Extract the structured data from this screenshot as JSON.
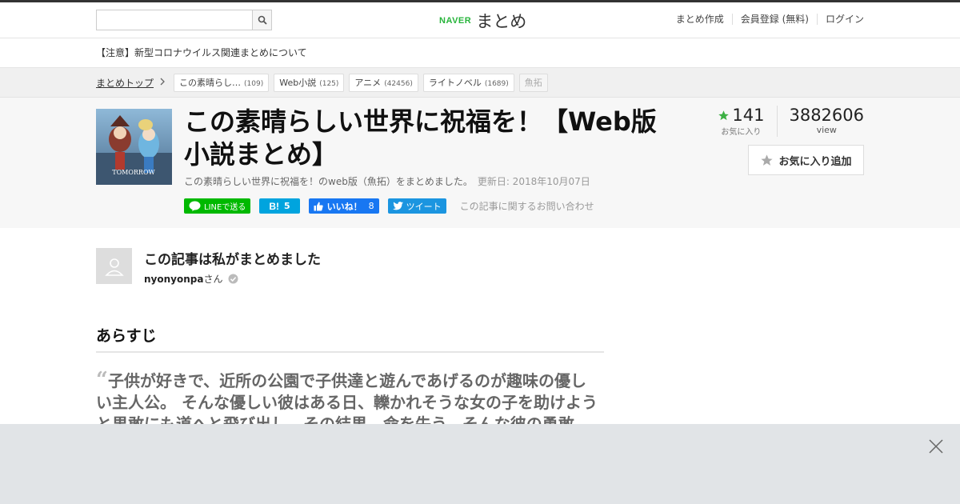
{
  "header": {
    "search_placeholder": "",
    "logo_brand": "NAVER",
    "logo_name": "まとめ",
    "nav": [
      "まとめ作成",
      "会員登録 (無料)",
      "ログイン"
    ]
  },
  "notice": "【注意】新型コロナウイルス関連まとめについて",
  "breadcrumb": {
    "home": "まとめトップ",
    "tags": [
      {
        "label": "この素晴らし…",
        "count": "(109)"
      },
      {
        "label": "Web小説",
        "count": "(125)"
      },
      {
        "label": "アニメ",
        "count": "(42456)"
      },
      {
        "label": "ライトノベル",
        "count": "(1689)"
      }
    ],
    "plain_tag": "魚拓"
  },
  "article": {
    "title": "この素晴らしい世界に祝福を！【Web版小説まとめ】",
    "description": "この素晴らしい世界に祝福を！のweb版（魚拓）をまとめました。",
    "updated": "更新日: 2018年10月07日",
    "thumbnail_text": "TOMORROW"
  },
  "share": {
    "line": "LINEで送る",
    "hatena_count": "5",
    "fb_label": "いいね！",
    "fb_count": "8",
    "tweet": "ツイート",
    "inquiry": "この記事に関するお問い合わせ"
  },
  "stats": {
    "favorites": "141",
    "favorites_label": "お気に入り",
    "views": "3882606",
    "views_label": "view",
    "fav_button": "お気に入り追加"
  },
  "author": {
    "heading": "この記事は私がまとめました",
    "name": "nyonyonpa",
    "suffix": "さん"
  },
  "section": {
    "heading": "あらすじ",
    "quote": "子供が好きで、近所の公園で子供達と遊んであげるのが趣味の優しい主人公。 そんな優しい彼はある日、轢かれそうな女の子を助けようと果敢にも道へと飛び出し、その結果、命を失う。そんな彼の勇敢"
  },
  "colors": {
    "naver_green": "#27b43b",
    "line_green": "#00b900",
    "hatena_blue": "#00a4de",
    "fb_blue": "#1877f2",
    "twitter_blue": "#1b95e0",
    "star_green": "#3cb043"
  }
}
